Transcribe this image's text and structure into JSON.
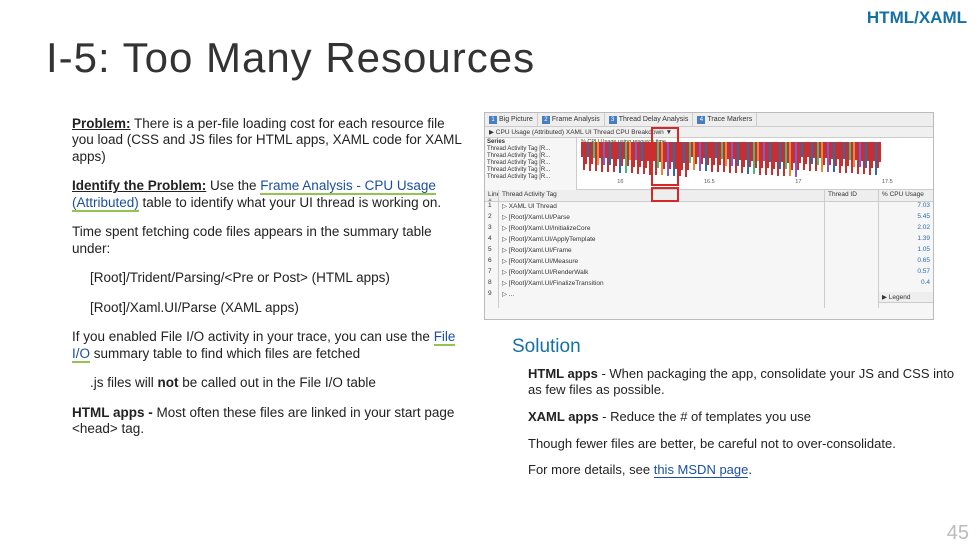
{
  "badge": "HTML/XAML",
  "title": "I-5: Too Many Resources",
  "left": {
    "problem_label": "Problem:",
    "problem_text": " There is a per-file loading cost for each resource file you load (CSS and JS files for HTML apps, XAML code for XAML apps)",
    "identify_label": "Identify the Problem:",
    "identify_pre": " Use the ",
    "identify_link": "Frame Analysis - CPU Usage (Attributed)",
    "identify_post": " table to identify what your UI thread is working on.",
    "fetching": "Time spent fetching code files appears in the summary table under:",
    "path_html": "[Root]/Trident/Parsing/<Pre or Post> (HTML apps)",
    "path_xaml": "[Root]/Xaml.UI/Parse (XAML apps)",
    "fileio_pre": "If you enabled File I/O activity in your trace, you can use the ",
    "fileio_link": "File I/O",
    "fileio_post": " summary table to find which files are fetched",
    "js_note_pre": ".js files will ",
    "js_note_bold": "not",
    "js_note_post": " be called out in the File I/O table",
    "htmlapps_label": "HTML apps -",
    "htmlapps_text": " Most often these files are linked in your start page <head> tag."
  },
  "screenshot": {
    "tabs": [
      "Big Picture",
      "Frame Analysis",
      "Thread Delay Analysis",
      "Trace Markers"
    ],
    "toolbar": "▶ CPU Usage (Attributed)   XAML UI Thread CPU Breakdown ▼",
    "series_label": "Series",
    "row_labels": [
      "Thread Activity Tag [R...",
      "Thread Activity Tag [R...",
      "Thread Activity Tag [R...",
      "Thread Activity Tag [R...",
      "Thread Activity Tag [R..."
    ],
    "legend_hint": "% CPU Usage using resource time...",
    "axis": [
      "16",
      "16.5",
      "17",
      "17.5"
    ],
    "headers": [
      "Line #",
      "Thread Activity Tag",
      "Thread ID",
      "% CPU Usage"
    ],
    "rows": [
      [
        "1",
        "▷ XAML UI Thread",
        "",
        "7.03"
      ],
      [
        "2",
        "▷ [Root]/Xaml.UI/Parse",
        "",
        "5.45"
      ],
      [
        "3",
        "▷    [Root]/Xaml.UI/InitializeCore",
        "",
        "2.02"
      ],
      [
        "4",
        "▷    [Root]/Xaml.UI/ApplyTemplate",
        "",
        "1.39"
      ],
      [
        "5",
        "▷    [Root]/Xaml.UI/Frame",
        "",
        "1.05"
      ],
      [
        "6",
        "▷    [Root]/Xaml.UI/Measure",
        "",
        "0.65"
      ],
      [
        "7",
        "▷    [Root]/Xaml.UI/RenderWalk",
        "",
        "0.57"
      ],
      [
        "8",
        "▷    [Root]/Xaml.UI/FinalizeTransition",
        "",
        "0.4"
      ],
      [
        "9",
        "▷    ...",
        "",
        ""
      ]
    ],
    "legend_col": "▶ Legend"
  },
  "solution": {
    "heading": "Solution",
    "html_label": "HTML apps",
    "html_text": " - When packaging the app, consolidate your JS and CSS into as few files as possible.",
    "xaml_label": "XAML apps",
    "xaml_text": " - Reduce the # of templates you use",
    "caution": "Though fewer files are better, be careful not to over-consolidate.",
    "details_pre": "For more details, see ",
    "details_link": "this MSDN page",
    "details_post": "."
  },
  "page_number": "45"
}
